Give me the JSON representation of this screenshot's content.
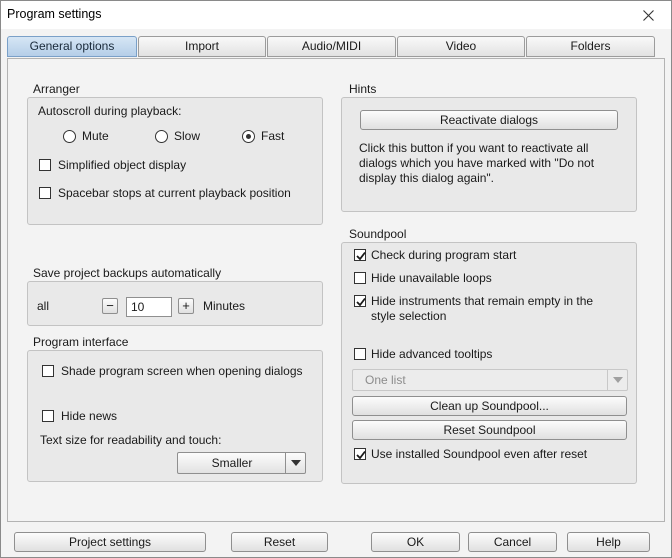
{
  "window": {
    "title": "Program settings"
  },
  "tabs": [
    {
      "label": "General options",
      "active": true
    },
    {
      "label": "Import",
      "active": false
    },
    {
      "label": "Audio/MIDI",
      "active": false
    },
    {
      "label": "Video",
      "active": false
    },
    {
      "label": "Folders",
      "active": false
    }
  ],
  "arranger": {
    "title": "Arranger",
    "autoscroll_label": "Autoscroll during playback:",
    "options": [
      {
        "label": "Mute",
        "selected": false
      },
      {
        "label": "Slow",
        "selected": false
      },
      {
        "label": "Fast",
        "selected": true
      }
    ],
    "simplified_display": {
      "label": "Simplified object display",
      "checked": false
    },
    "spacebar_stops": {
      "label": "Spacebar stops at current playback position",
      "checked": false
    }
  },
  "backups": {
    "title": "Save project backups automatically",
    "prefix": "all",
    "value": "10",
    "minus": "−",
    "plus": "+",
    "unit": "Minutes"
  },
  "interface": {
    "title": "Program interface",
    "shade_screen": {
      "label": "Shade program screen when opening dialogs",
      "checked": false
    },
    "hide_news": {
      "label": "Hide news",
      "checked": false
    },
    "text_size_label": "Text size for readability and touch:",
    "text_size_value": "Smaller"
  },
  "hints": {
    "title": "Hints",
    "reactivate_label": "Reactivate dialogs",
    "description": "Click this button if you want to reactivate all dialogs which you have marked with \"Do not display this dialog again\"."
  },
  "soundpool": {
    "title": "Soundpool",
    "check_start": {
      "label": "Check during program start",
      "checked": true
    },
    "hide_loops": {
      "label": "Hide unavailable loops",
      "checked": false
    },
    "hide_instruments": {
      "label": "Hide instruments that remain empty in the style selection",
      "checked": true
    },
    "hide_tooltips": {
      "label": "Hide advanced tooltips",
      "checked": false
    },
    "list_value": "One list",
    "clean_up_label": "Clean up Soundpool...",
    "reset_label": "Reset Soundpool",
    "use_installed": {
      "label": "Use installed Soundpool even after reset",
      "checked": true
    }
  },
  "footer": {
    "project_settings": "Project settings",
    "reset": "Reset",
    "ok": "OK",
    "cancel": "Cancel",
    "help": "Help"
  },
  "icons": {
    "close": "close-icon",
    "check": "check-icon",
    "dropdown": "chevron-down-icon"
  }
}
